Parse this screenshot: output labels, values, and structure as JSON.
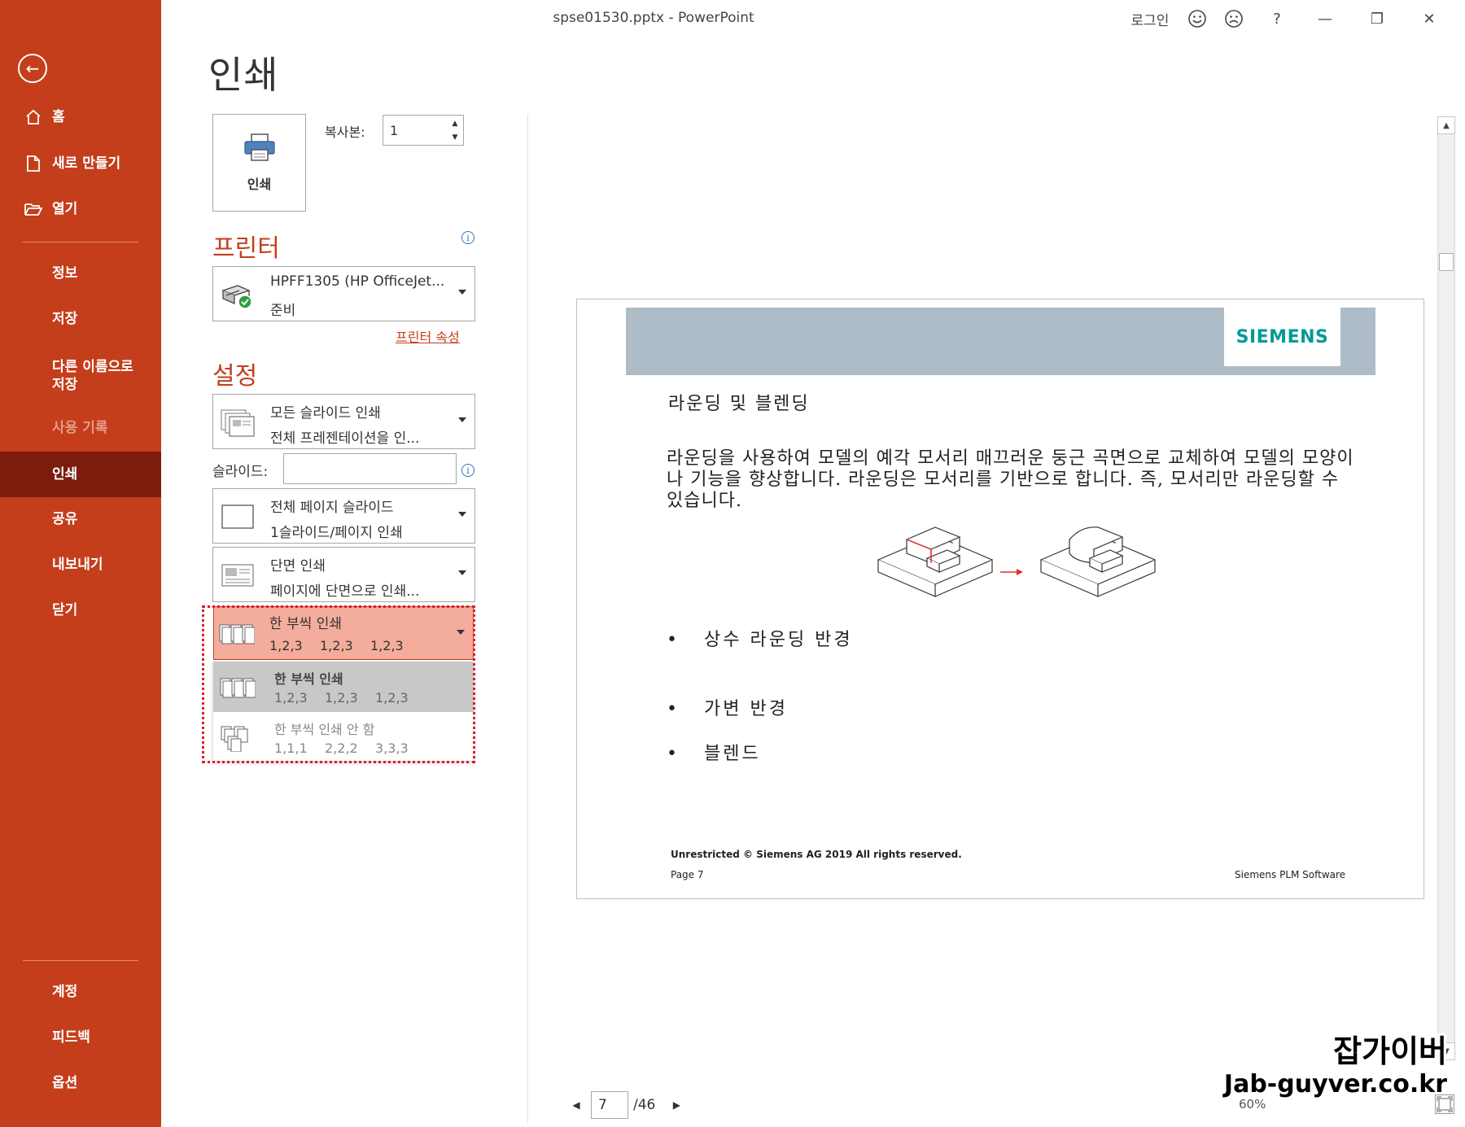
{
  "window": {
    "title": "spse01530.pptx  -  PowerPoint",
    "login": "로그인",
    "help": "?",
    "minimize": "—",
    "restore": "❐",
    "close": "✕"
  },
  "sidebar": {
    "back_icon": "back-arrow-icon",
    "items": [
      {
        "label": "홈",
        "icon": "home-icon"
      },
      {
        "label": "새로 만들기",
        "icon": "new-document-icon"
      },
      {
        "label": "열기",
        "icon": "folder-open-icon"
      },
      {
        "label": "정보"
      },
      {
        "label": "저장"
      },
      {
        "label": "다른 이름으로 저장"
      },
      {
        "label": "사용 기록",
        "disabled": true
      },
      {
        "label": "인쇄",
        "active": true
      },
      {
        "label": "공유"
      },
      {
        "label": "내보내기"
      },
      {
        "label": "닫기"
      },
      {
        "label": "계정"
      },
      {
        "label": "피드백"
      },
      {
        "label": "옵션"
      }
    ]
  },
  "print": {
    "page_title": "인쇄",
    "print_button": "인쇄",
    "copies_label": "복사본:",
    "copies_value": "1",
    "printer_section": "프린터",
    "printer_name": "HPFF1305 (HP OfficeJet...",
    "printer_status": "준비",
    "printer_properties": "프린터 속성",
    "settings_section": "설정",
    "range_line1": "모든 슬라이드 인쇄",
    "range_line2": "전체 프레젠테이션을 인...",
    "slides_label": "슬라이드:",
    "slides_value": "",
    "layout_line1": "전체 페이지 슬라이드",
    "layout_line2": "1슬라이드/페이지 인쇄",
    "sides_line1": "단면 인쇄",
    "sides_line2": "페이지에 단면으로 인쇄...",
    "collate_selected_line1": "한 부씩 인쇄",
    "collate_selected_seq": [
      "1,2,3",
      "1,2,3",
      "1,2,3"
    ],
    "collate_options": [
      {
        "line1": "한 부씩 인쇄",
        "seq": [
          "1,2,3",
          "1,2,3",
          "1,2,3"
        ],
        "highlighted": true
      },
      {
        "line1": "한 부씩 인쇄 안 함",
        "seq": [
          "1,1,1",
          "2,2,2",
          "3,3,3"
        ],
        "highlighted": false
      }
    ]
  },
  "preview": {
    "logo": "SIEMENS",
    "slide_title": "라운딩 및 블렌딩",
    "body": "라운딩을 사용하여 모델의 예각 모서리 매끄러운 둥근 곡면으로 교체하여 모델의 모양이나 기능을 향상합니다. 라운딩은 모서리를 기반으로 합니다. 즉, 모서리만 라운딩할 수 있습니다.",
    "bullets": [
      "상수 라운딩 반경",
      "가변 반경",
      "블렌드"
    ],
    "footer_copyright": "Unrestricted © Siemens AG 2019 All rights reserved.",
    "footer_page": "Page 7",
    "footer_brand": "Siemens PLM Software",
    "current_page": "7",
    "total_pages": "/46",
    "zoom": "60%"
  },
  "watermark": {
    "line1": "잡가이버",
    "line2": "Jab-guyver.co.kr"
  },
  "colors": {
    "accent": "#c43e1c",
    "active_nav": "#7b1c0d",
    "highlight": "#f4ad9c",
    "siemens_teal": "#009999"
  }
}
